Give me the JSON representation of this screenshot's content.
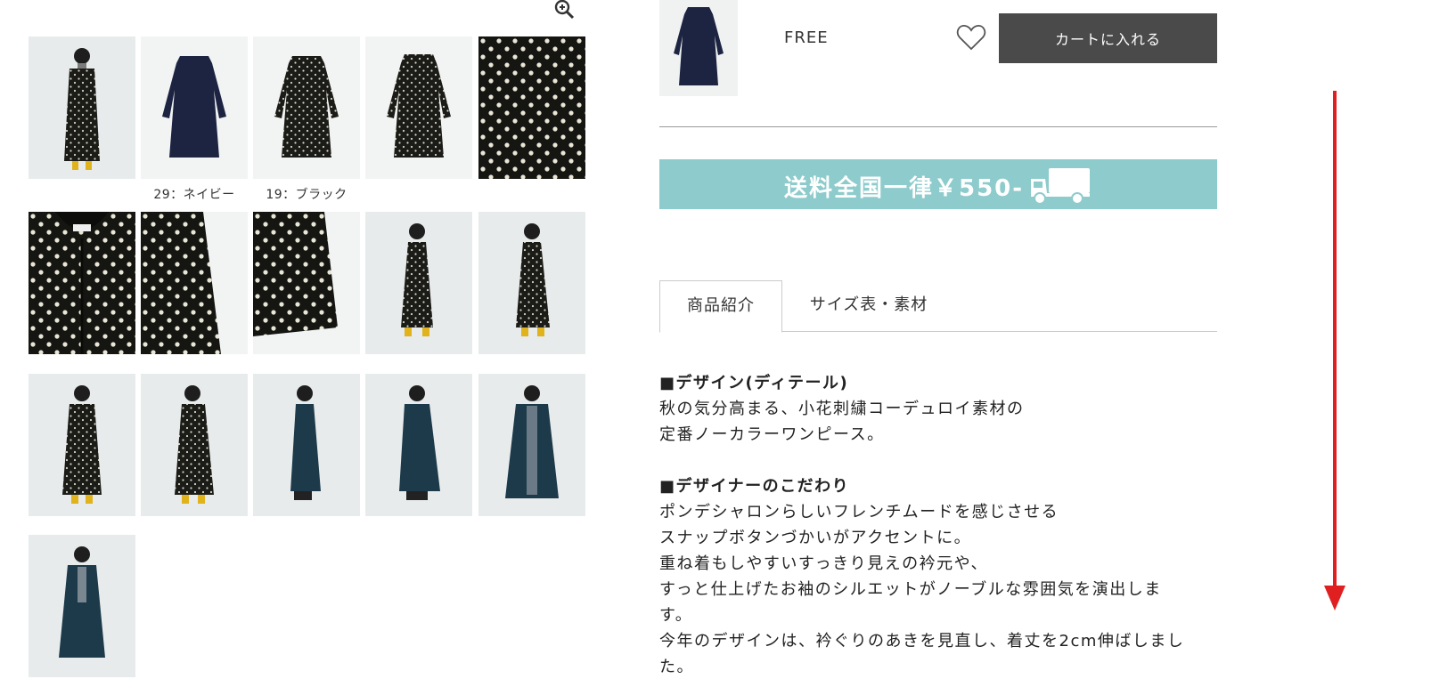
{
  "gallery": {
    "captions": [
      "29：ネイビー",
      "19：ブラック"
    ]
  },
  "purchase": {
    "size": "FREE",
    "cart_label": "カートに入れる"
  },
  "banner": {
    "text": "送料全国一律￥550-"
  },
  "tabs": [
    {
      "label": "商品紹介",
      "active": true
    },
    {
      "label": "サイズ表・素材",
      "active": false
    }
  ],
  "description": {
    "heading1": "■デザイン(ディテール)",
    "p1_line1": "秋の気分高まる、小花刺繍コーデュロイ素材の",
    "p1_line2": "定番ノーカラーワンピース。",
    "heading2": "■デザイナーのこだわり",
    "p2_line1": "ポンデシャロンらしいフレンチムードを感じさせる",
    "p2_line2": "スナップボタンづかいがアクセントに。",
    "p2_line3": "重ね着もしやすいすっきり見えの衿元や、",
    "p2_line4": "すっと仕上げたお袖のシルエットがノーブルな雰囲気を演出しま",
    "p2_line5": "す。",
    "p2_line6": "今年のデザインは、衿ぐりのあきを見直し、着丈を2cm伸ばしまし",
    "p2_line7": "た。"
  },
  "colors": {
    "banner": "#8ecbcc",
    "cart_button": "#4a4a4a",
    "arrow": "#e02020"
  }
}
